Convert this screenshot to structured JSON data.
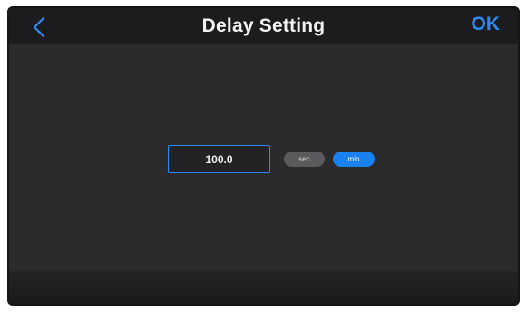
{
  "header": {
    "title": "Delay Setting",
    "back_icon": "chevron-left-icon",
    "ok_label": "OK"
  },
  "delay": {
    "value": "100.0",
    "units": [
      "sec",
      "min"
    ],
    "selected_unit": "min"
  },
  "colors": {
    "accent": "#2b8af7",
    "screen_bg": "#2b2b2d",
    "header_bg": "#1c1c1e"
  }
}
